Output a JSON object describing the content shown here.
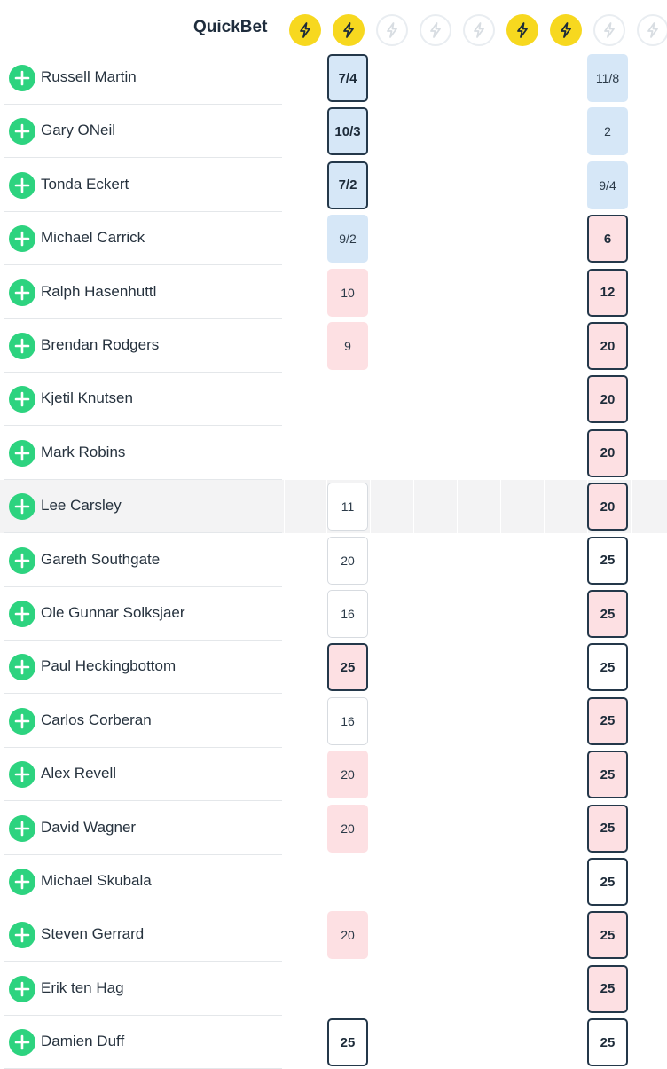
{
  "header": {
    "quickbet_label": "QuickBet",
    "bolt_states": [
      true,
      true,
      false,
      false,
      false,
      true,
      true,
      false,
      false
    ]
  },
  "colors": {
    "bolt_active": "#f7d81f",
    "add_button": "#2dd37f",
    "odds_blue": "#d6e7f7",
    "odds_pink": "#fde0e3",
    "odds_border_dark": "#24384a"
  },
  "icons": {
    "bolt": "lightning-bolt-icon",
    "add": "plus-icon"
  },
  "rows": [
    {
      "name": "Russell Martin",
      "odds_a": "7/4",
      "a_style": "blue",
      "a_bold": true,
      "odds_b": "11/8",
      "b_style": "blue",
      "b_bold": false
    },
    {
      "name": "Gary ONeil",
      "odds_a": "10/3",
      "a_style": "blue",
      "a_bold": true,
      "odds_b": "2",
      "b_style": "blue",
      "b_bold": false
    },
    {
      "name": "Tonda Eckert",
      "odds_a": "7/2",
      "a_style": "blue",
      "a_bold": true,
      "odds_b": "9/4",
      "b_style": "blue",
      "b_bold": false
    },
    {
      "name": "Michael Carrick",
      "odds_a": "9/2",
      "a_style": "blue",
      "a_bold": false,
      "odds_b": "6",
      "b_style": "pink",
      "b_bold": true
    },
    {
      "name": "Ralph Hasenhuttl",
      "odds_a": "10",
      "a_style": "pink",
      "a_bold": false,
      "odds_b": "12",
      "b_style": "pink",
      "b_bold": true
    },
    {
      "name": "Brendan Rodgers",
      "odds_a": "9",
      "a_style": "pink",
      "a_bold": false,
      "odds_b": "20",
      "b_style": "pink",
      "b_bold": true
    },
    {
      "name": "Kjetil Knutsen",
      "odds_a": "",
      "a_style": "",
      "a_bold": false,
      "odds_b": "20",
      "b_style": "pink",
      "b_bold": true
    },
    {
      "name": "Mark Robins",
      "odds_a": "",
      "a_style": "",
      "a_bold": false,
      "odds_b": "20",
      "b_style": "pink",
      "b_bold": true
    },
    {
      "name": "Lee Carsley",
      "odds_a": "11",
      "a_style": "white",
      "a_bold": false,
      "odds_b": "20",
      "b_style": "pink",
      "b_bold": true,
      "highlight": true
    },
    {
      "name": "Gareth Southgate",
      "odds_a": "20",
      "a_style": "white",
      "a_bold": false,
      "odds_b": "25",
      "b_style": "white",
      "b_bold": true
    },
    {
      "name": "Ole Gunnar Solksjaer",
      "odds_a": "16",
      "a_style": "white",
      "a_bold": false,
      "odds_b": "25",
      "b_style": "pink",
      "b_bold": true
    },
    {
      "name": "Paul Heckingbottom",
      "odds_a": "25",
      "a_style": "pink",
      "a_bold": true,
      "odds_b": "25",
      "b_style": "white",
      "b_bold": true
    },
    {
      "name": "Carlos Corberan",
      "odds_a": "16",
      "a_style": "white",
      "a_bold": false,
      "odds_b": "25",
      "b_style": "pink",
      "b_bold": true
    },
    {
      "name": "Alex Revell",
      "odds_a": "20",
      "a_style": "pink",
      "a_bold": false,
      "odds_b": "25",
      "b_style": "pink",
      "b_bold": true
    },
    {
      "name": "David Wagner",
      "odds_a": "20",
      "a_style": "pink",
      "a_bold": false,
      "odds_b": "25",
      "b_style": "pink",
      "b_bold": true
    },
    {
      "name": "Michael Skubala",
      "odds_a": "",
      "a_style": "",
      "a_bold": false,
      "odds_b": "25",
      "b_style": "white",
      "b_bold": true
    },
    {
      "name": "Steven Gerrard",
      "odds_a": "20",
      "a_style": "pink",
      "a_bold": false,
      "odds_b": "25",
      "b_style": "pink",
      "b_bold": true
    },
    {
      "name": "Erik ten Hag",
      "odds_a": "",
      "a_style": "",
      "a_bold": false,
      "odds_b": "25",
      "b_style": "pink",
      "b_bold": true
    },
    {
      "name": "Damien Duff",
      "odds_a": "25",
      "a_style": "white",
      "a_bold": true,
      "odds_b": "25",
      "b_style": "white",
      "b_bold": true
    }
  ]
}
